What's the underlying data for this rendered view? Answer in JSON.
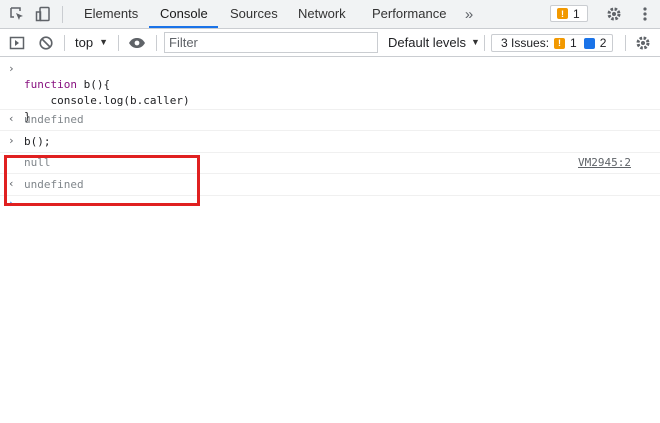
{
  "tabs": [
    {
      "label": "Elements"
    },
    {
      "label": "Console"
    },
    {
      "label": "Sources"
    },
    {
      "label": "Network"
    },
    {
      "label": "Performance"
    }
  ],
  "more_tabs_icon": "chevron-double-right-icon",
  "header_warning_count": "1",
  "toolbar": {
    "context": "top",
    "filter_placeholder": "Filter",
    "levels": "Default levels",
    "issues_label": "3 Issues:",
    "issues_warning": "1",
    "issues_info": "2"
  },
  "console": {
    "line1_kw": "function",
    "line1_rest": " b(){",
    "line2": "    console.log(b.caller)",
    "line3": "}",
    "result1": "undefined",
    "input2": "b();",
    "log_null": "null",
    "log_source": "VM2945:2",
    "result2": "undefined"
  },
  "colors": {
    "accent": "#1a73e8",
    "warning": "#f29900",
    "highlight_box": "#e02020",
    "keyword": "#881280"
  }
}
